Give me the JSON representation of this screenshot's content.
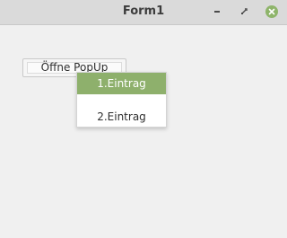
{
  "window": {
    "title": "Form1",
    "accent_color": "#8eb06c"
  },
  "titlebar_buttons": {
    "minimize": "minimize-icon",
    "maximize": "restore-icon",
    "close": "close-icon"
  },
  "button": {
    "label": "Öffne PopUp"
  },
  "menu": {
    "items": [
      {
        "label": "1.Eintrag",
        "selected": true
      },
      {
        "label": "2.Eintrag",
        "selected": false
      }
    ]
  }
}
